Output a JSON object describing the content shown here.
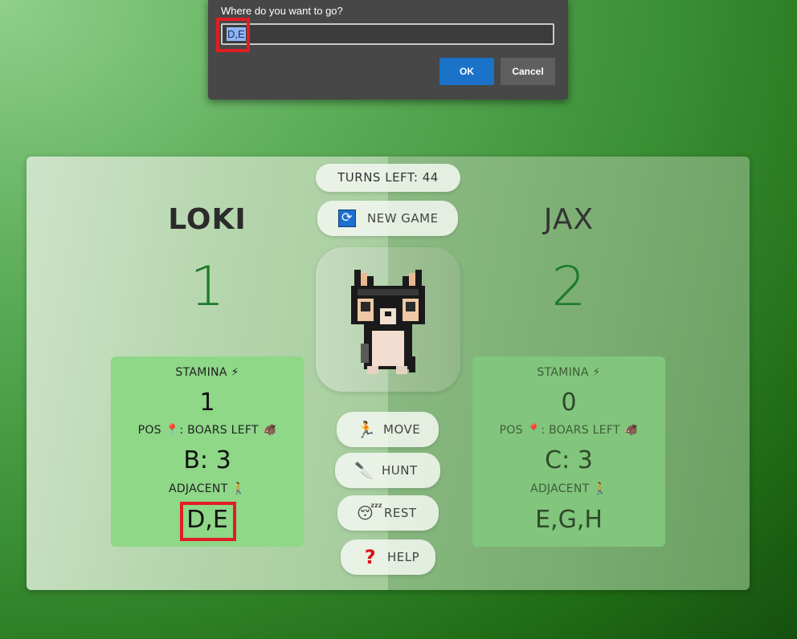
{
  "dialog": {
    "message": "Where do you want to go?",
    "input_value": "D,E",
    "ok_label": "OK",
    "cancel_label": "Cancel"
  },
  "game": {
    "turns_left": "TURNS LEFT: 44",
    "new_game_label": "NEW GAME",
    "actions": {
      "move": "MOVE",
      "hunt": "HUNT",
      "rest": "REST",
      "help": "HELP"
    }
  },
  "players": {
    "loki": {
      "name": "LOKI",
      "score": "1",
      "stamina_label": "STAMINA ⚡",
      "stamina": "1",
      "pos_label": "POS 📍: BOARS LEFT 🐗",
      "pos": "B: 3",
      "adjacent_label": "ADJACENT 🚶",
      "adjacent": "D,E"
    },
    "jax": {
      "name": "JAX",
      "score": "2",
      "stamina_label": "STAMINA ⚡",
      "stamina": "0",
      "pos_label": "POS 📍: BOARS LEFT 🐗",
      "pos": "C: 3",
      "adjacent_label": "ADJACENT 🚶",
      "adjacent": "E,G,H"
    }
  },
  "icons": {
    "new_game": "refresh-icon",
    "move": "running-person-icon",
    "hunt": "knife-icon",
    "rest": "sleeping-face-icon",
    "help": "question-mark-icon",
    "portrait": "pixel-cat-icon"
  },
  "colors": {
    "score": "#1e7b2a",
    "highlight": "#e11d24",
    "ok_button": "#1a73c9"
  }
}
